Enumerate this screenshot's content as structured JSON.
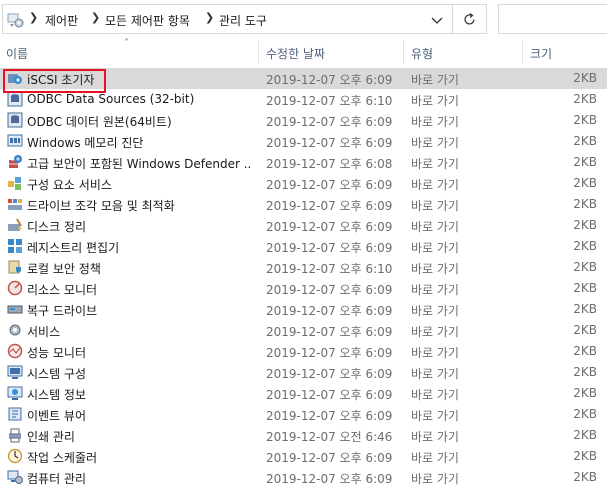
{
  "address": {
    "crumbs": [
      "제어판",
      "모든 제어판 항목",
      "관리 도구"
    ],
    "icon": "control-panel-icon"
  },
  "columns": {
    "name": "이름",
    "modified": "수정한 날짜",
    "type": "유형",
    "size": "크기"
  },
  "files": [
    {
      "name": "iSCSI 초기자",
      "date": "2019-12-07 오후 6:09",
      "type": "바로 가기",
      "size": "2KB",
      "icon": "iscsi-icon",
      "selected": true
    },
    {
      "name": "ODBC Data Sources (32-bit)",
      "date": "2019-12-07 오후 6:10",
      "type": "바로 가기",
      "size": "2KB",
      "icon": "odbc-icon"
    },
    {
      "name": "ODBC 데이터 원본(64비트)",
      "date": "2019-12-07 오후 6:09",
      "type": "바로 가기",
      "size": "2KB",
      "icon": "odbc-icon"
    },
    {
      "name": "Windows 메모리 진단",
      "date": "2019-12-07 오후 6:09",
      "type": "바로 가기",
      "size": "2KB",
      "icon": "memory-diagnostic-icon"
    },
    {
      "name": "고급 보안이 포함된 Windows Defender ...",
      "date": "2019-12-07 오후 6:08",
      "type": "바로 가기",
      "size": "2KB",
      "icon": "firewall-icon"
    },
    {
      "name": "구성 요소 서비스",
      "date": "2019-12-07 오후 6:09",
      "type": "바로 가기",
      "size": "2KB",
      "icon": "component-services-icon"
    },
    {
      "name": "드라이브 조각 모음 및 최적화",
      "date": "2019-12-07 오후 6:09",
      "type": "바로 가기",
      "size": "2KB",
      "icon": "defrag-icon"
    },
    {
      "name": "디스크 정리",
      "date": "2019-12-07 오후 6:09",
      "type": "바로 가기",
      "size": "2KB",
      "icon": "disk-cleanup-icon"
    },
    {
      "name": "레지스트리 편집기",
      "date": "2019-12-07 오후 6:09",
      "type": "바로 가기",
      "size": "2KB",
      "icon": "registry-icon"
    },
    {
      "name": "로컬 보안 정책",
      "date": "2019-12-07 오후 6:10",
      "type": "바로 가기",
      "size": "2KB",
      "icon": "security-policy-icon"
    },
    {
      "name": "리소스 모니터",
      "date": "2019-12-07 오후 6:09",
      "type": "바로 가기",
      "size": "2KB",
      "icon": "resource-monitor-icon"
    },
    {
      "name": "복구 드라이브",
      "date": "2019-12-07 오후 6:09",
      "type": "바로 가기",
      "size": "2KB",
      "icon": "recovery-drive-icon"
    },
    {
      "name": "서비스",
      "date": "2019-12-07 오후 6:09",
      "type": "바로 가기",
      "size": "2KB",
      "icon": "services-icon"
    },
    {
      "name": "성능 모니터",
      "date": "2019-12-07 오후 6:09",
      "type": "바로 가기",
      "size": "2KB",
      "icon": "performance-monitor-icon"
    },
    {
      "name": "시스템 구성",
      "date": "2019-12-07 오후 6:09",
      "type": "바로 가기",
      "size": "2KB",
      "icon": "system-config-icon"
    },
    {
      "name": "시스템 정보",
      "date": "2019-12-07 오후 6:09",
      "type": "바로 가기",
      "size": "2KB",
      "icon": "system-info-icon"
    },
    {
      "name": "이벤트 뷰어",
      "date": "2019-12-07 오후 6:09",
      "type": "바로 가기",
      "size": "2KB",
      "icon": "event-viewer-icon"
    },
    {
      "name": "인쇄 관리",
      "date": "2019-12-07 오전 6:46",
      "type": "바로 가기",
      "size": "2KB",
      "icon": "print-management-icon"
    },
    {
      "name": "작업 스케줄러",
      "date": "2019-12-07 오후 6:09",
      "type": "바로 가기",
      "size": "2KB",
      "icon": "task-scheduler-icon"
    },
    {
      "name": "컴퓨터 관리",
      "date": "2019-12-07 오후 6:09",
      "type": "바로 가기",
      "size": "2KB",
      "icon": "computer-management-icon"
    }
  ],
  "colors": {
    "selected_row": "#d9d9d9",
    "highlight": "#e81123",
    "header_text": "#4c607a",
    "secondary_text": "#6d6d6d"
  }
}
